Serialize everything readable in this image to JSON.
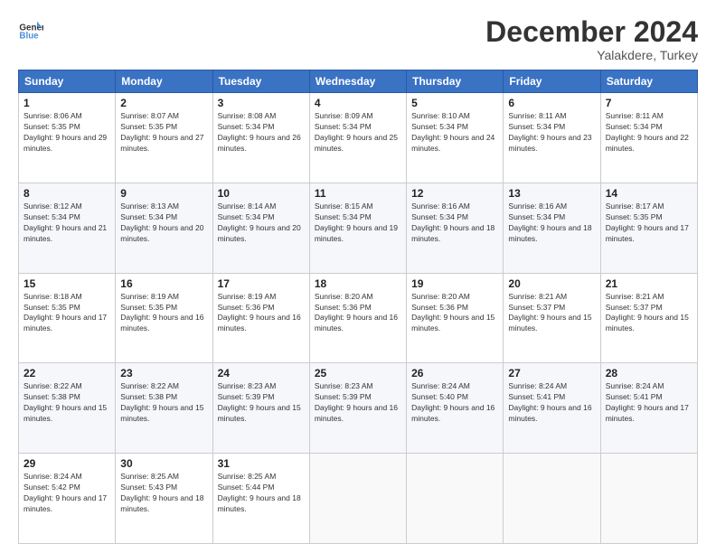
{
  "logo": {
    "line1": "General",
    "line2": "Blue"
  },
  "header": {
    "month": "December 2024",
    "location": "Yalakdere, Turkey"
  },
  "weekdays": [
    "Sunday",
    "Monday",
    "Tuesday",
    "Wednesday",
    "Thursday",
    "Friday",
    "Saturday"
  ],
  "weeks": [
    [
      {
        "day": 1,
        "sunrise": "8:06 AM",
        "sunset": "5:35 PM",
        "daylight": "9 hours and 29 minutes."
      },
      {
        "day": 2,
        "sunrise": "8:07 AM",
        "sunset": "5:35 PM",
        "daylight": "9 hours and 27 minutes."
      },
      {
        "day": 3,
        "sunrise": "8:08 AM",
        "sunset": "5:34 PM",
        "daylight": "9 hours and 26 minutes."
      },
      {
        "day": 4,
        "sunrise": "8:09 AM",
        "sunset": "5:34 PM",
        "daylight": "9 hours and 25 minutes."
      },
      {
        "day": 5,
        "sunrise": "8:10 AM",
        "sunset": "5:34 PM",
        "daylight": "9 hours and 24 minutes."
      },
      {
        "day": 6,
        "sunrise": "8:11 AM",
        "sunset": "5:34 PM",
        "daylight": "9 hours and 23 minutes."
      },
      {
        "day": 7,
        "sunrise": "8:11 AM",
        "sunset": "5:34 PM",
        "daylight": "9 hours and 22 minutes."
      }
    ],
    [
      {
        "day": 8,
        "sunrise": "8:12 AM",
        "sunset": "5:34 PM",
        "daylight": "9 hours and 21 minutes."
      },
      {
        "day": 9,
        "sunrise": "8:13 AM",
        "sunset": "5:34 PM",
        "daylight": "9 hours and 20 minutes."
      },
      {
        "day": 10,
        "sunrise": "8:14 AM",
        "sunset": "5:34 PM",
        "daylight": "9 hours and 20 minutes."
      },
      {
        "day": 11,
        "sunrise": "8:15 AM",
        "sunset": "5:34 PM",
        "daylight": "9 hours and 19 minutes."
      },
      {
        "day": 12,
        "sunrise": "8:16 AM",
        "sunset": "5:34 PM",
        "daylight": "9 hours and 18 minutes."
      },
      {
        "day": 13,
        "sunrise": "8:16 AM",
        "sunset": "5:34 PM",
        "daylight": "9 hours and 18 minutes."
      },
      {
        "day": 14,
        "sunrise": "8:17 AM",
        "sunset": "5:35 PM",
        "daylight": "9 hours and 17 minutes."
      }
    ],
    [
      {
        "day": 15,
        "sunrise": "8:18 AM",
        "sunset": "5:35 PM",
        "daylight": "9 hours and 17 minutes."
      },
      {
        "day": 16,
        "sunrise": "8:19 AM",
        "sunset": "5:35 PM",
        "daylight": "9 hours and 16 minutes."
      },
      {
        "day": 17,
        "sunrise": "8:19 AM",
        "sunset": "5:36 PM",
        "daylight": "9 hours and 16 minutes."
      },
      {
        "day": 18,
        "sunrise": "8:20 AM",
        "sunset": "5:36 PM",
        "daylight": "9 hours and 16 minutes."
      },
      {
        "day": 19,
        "sunrise": "8:20 AM",
        "sunset": "5:36 PM",
        "daylight": "9 hours and 15 minutes."
      },
      {
        "day": 20,
        "sunrise": "8:21 AM",
        "sunset": "5:37 PM",
        "daylight": "9 hours and 15 minutes."
      },
      {
        "day": 21,
        "sunrise": "8:21 AM",
        "sunset": "5:37 PM",
        "daylight": "9 hours and 15 minutes."
      }
    ],
    [
      {
        "day": 22,
        "sunrise": "8:22 AM",
        "sunset": "5:38 PM",
        "daylight": "9 hours and 15 minutes."
      },
      {
        "day": 23,
        "sunrise": "8:22 AM",
        "sunset": "5:38 PM",
        "daylight": "9 hours and 15 minutes."
      },
      {
        "day": 24,
        "sunrise": "8:23 AM",
        "sunset": "5:39 PM",
        "daylight": "9 hours and 15 minutes."
      },
      {
        "day": 25,
        "sunrise": "8:23 AM",
        "sunset": "5:39 PM",
        "daylight": "9 hours and 16 minutes."
      },
      {
        "day": 26,
        "sunrise": "8:24 AM",
        "sunset": "5:40 PM",
        "daylight": "9 hours and 16 minutes."
      },
      {
        "day": 27,
        "sunrise": "8:24 AM",
        "sunset": "5:41 PM",
        "daylight": "9 hours and 16 minutes."
      },
      {
        "day": 28,
        "sunrise": "8:24 AM",
        "sunset": "5:41 PM",
        "daylight": "9 hours and 17 minutes."
      }
    ],
    [
      {
        "day": 29,
        "sunrise": "8:24 AM",
        "sunset": "5:42 PM",
        "daylight": "9 hours and 17 minutes."
      },
      {
        "day": 30,
        "sunrise": "8:25 AM",
        "sunset": "5:43 PM",
        "daylight": "9 hours and 18 minutes."
      },
      {
        "day": 31,
        "sunrise": "8:25 AM",
        "sunset": "5:44 PM",
        "daylight": "9 hours and 18 minutes."
      },
      null,
      null,
      null,
      null
    ]
  ]
}
